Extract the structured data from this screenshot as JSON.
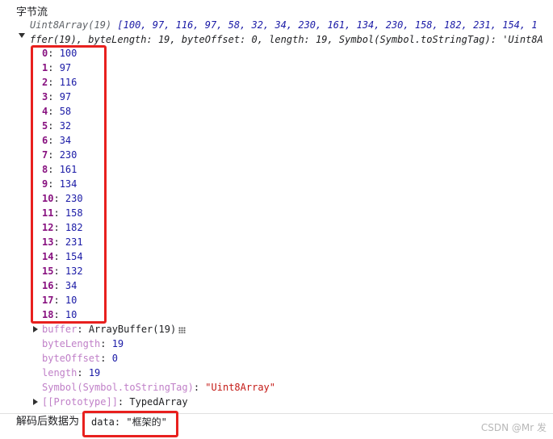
{
  "title": "字节流",
  "summary": {
    "type_name": "Uint8Array(19)",
    "preview": "[100, 97, 116, 97, 58, 32, 34, 230, 161, 134, 230, 158, 182, 231, 154, 1",
    "second_line": "ffer(19), byteLength: 19, byteOffset: 0, length: 19, Symbol(Symbol.toStringTag): 'Uint8A"
  },
  "entries": [
    {
      "index": "0",
      "value": "100"
    },
    {
      "index": "1",
      "value": "97"
    },
    {
      "index": "2",
      "value": "116"
    },
    {
      "index": "3",
      "value": "97"
    },
    {
      "index": "4",
      "value": "58"
    },
    {
      "index": "5",
      "value": "32"
    },
    {
      "index": "6",
      "value": "34"
    },
    {
      "index": "7",
      "value": "230"
    },
    {
      "index": "8",
      "value": "161"
    },
    {
      "index": "9",
      "value": "134"
    },
    {
      "index": "10",
      "value": "230"
    },
    {
      "index": "11",
      "value": "158"
    },
    {
      "index": "12",
      "value": "182"
    },
    {
      "index": "13",
      "value": "231"
    },
    {
      "index": "14",
      "value": "154"
    },
    {
      "index": "15",
      "value": "132"
    },
    {
      "index": "16",
      "value": "34"
    },
    {
      "index": "17",
      "value": "10"
    },
    {
      "index": "18",
      "value": "10"
    }
  ],
  "props": {
    "buffer_key": "buffer",
    "buffer_value": "ArrayBuffer(19)",
    "byteLength_key": "byteLength",
    "byteLength_value": "19",
    "byteOffset_key": "byteOffset",
    "byteOffset_value": "0",
    "length_key": "length",
    "length_value": "19",
    "tag_key": "Symbol(Symbol.toStringTag)",
    "tag_value": "\"Uint8Array\"",
    "proto_key": "[[Prototype]]",
    "proto_value": "TypedArray"
  },
  "decoded": {
    "label": "解码后数据为",
    "value": "data: \"框架的\""
  },
  "watermark": "CSDN @Mr 发",
  "colors": {
    "highlight_box": "#e8201e",
    "key": "#881280",
    "number": "#1a1aa6",
    "string": "#c41a16"
  }
}
